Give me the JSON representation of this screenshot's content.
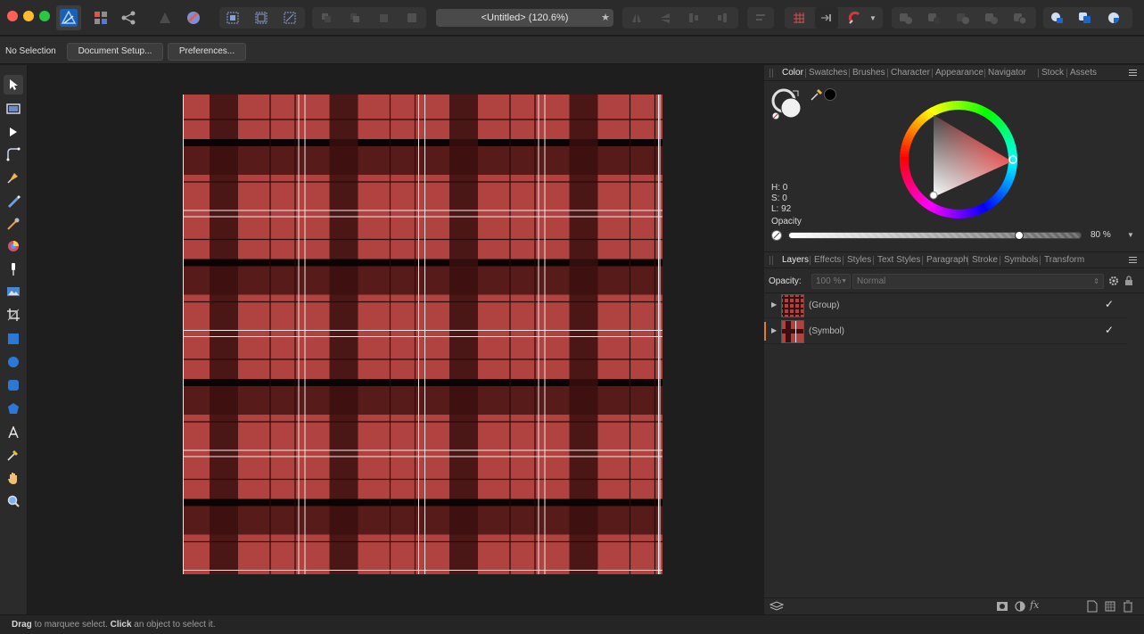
{
  "window": {
    "document_title": "<Untitled> (120.6%)",
    "favorite_glyph": "★"
  },
  "toolbar": {
    "icons": [
      "affinity-designer-icon",
      "designer-persona-icon",
      "pixel-persona-icon",
      "export-persona-icon",
      "place-icon",
      "snapping-icons",
      "arrange-icons",
      "transform-icons",
      "align-icon",
      "boolean-icons"
    ]
  },
  "context_bar": {
    "selection_label": "No Selection",
    "document_setup_label": "Document Setup...",
    "preferences_label": "Preferences..."
  },
  "color_panel": {
    "tabs": [
      "Color",
      "Swatches",
      "Brushes",
      "Character",
      "Appearance",
      "Navigator",
      "Stock",
      "Assets"
    ],
    "active_tab": "Color",
    "h": "H: 0",
    "s": "S: 0",
    "l": "L: 92",
    "opacity_label": "Opacity",
    "opacity_value": "80 %",
    "opacity_fraction": 0.8,
    "selected_hue_color": "#ff3b2f"
  },
  "layers_panel": {
    "tabs": [
      "Layers",
      "Effects",
      "Styles",
      "Text Styles",
      "Paragraph",
      "Stroke",
      "Symbols",
      "Transform"
    ],
    "active_tab": "Layers",
    "opacity_label": "Opacity:",
    "opacity_value": "100 %",
    "blend_mode": "Normal",
    "layers": [
      {
        "name": "(Group)",
        "visible": "✓"
      },
      {
        "name": "(Symbol)",
        "visible": "✓"
      }
    ]
  },
  "status_bar": {
    "drag_bold": "Drag",
    "drag_text": " to marquee select. ",
    "click_bold": "Click",
    "click_text": " an object to select it."
  },
  "colors": {
    "plaid_red": "#b0433f",
    "plaid_dark": "#3a0f0f",
    "plaid_black": "#0a0404",
    "accent_blue": "#2a7de1"
  }
}
